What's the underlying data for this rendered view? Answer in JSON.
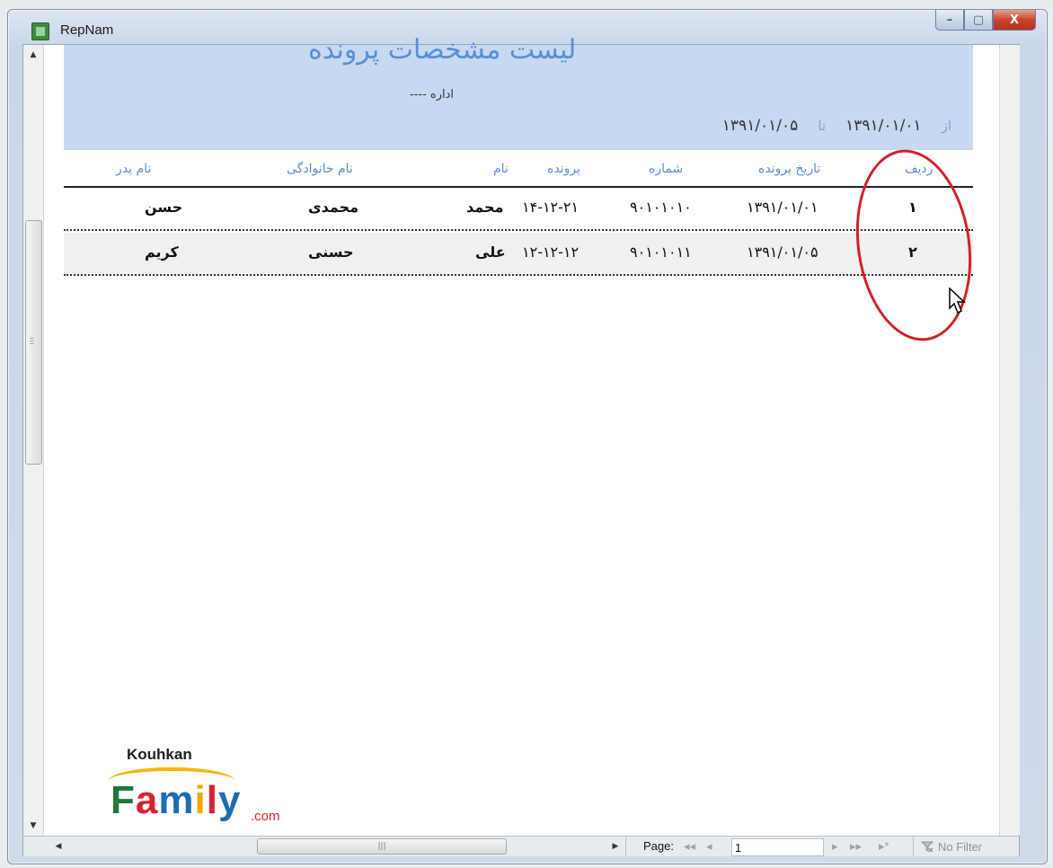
{
  "window": {
    "title": "RepNam",
    "minimize": "–",
    "maximize": "▢",
    "close": "X"
  },
  "report": {
    "title": "لیست مشخصات پرونده",
    "office": "اداره ----",
    "range_from_label": "از",
    "range_from": "۱۳۹۱/۰۱/۰۱",
    "range_to_label": "تا",
    "range_to": "۱۳۹۱/۰۱/۰۵",
    "columns": {
      "row": "ردیف",
      "date": "تاریخ پرونده",
      "number": "شماره",
      "file": "پرونده",
      "name": "نام",
      "family": "نام خانوادگی",
      "father": "نام پدر"
    },
    "rows": [
      {
        "row": "۱",
        "date": "۱۳۹۱/۰۱/۰۱",
        "number": "۹۰۱۰۱۰۱۰",
        "file": "۱۴-۱۲-۲۱",
        "name": "محمد",
        "family": "محمدی",
        "father": "حسن"
      },
      {
        "row": "۲",
        "date": "۱۳۹۱/۰۱/۰۵",
        "number": "۹۰۱۰۱۰۱۱",
        "file": "۱۲-۱۲-۱۲",
        "name": "علی",
        "family": "حسنی",
        "father": "کریم"
      }
    ]
  },
  "watermark": {
    "line1": "Kouhkan",
    "line2": "Family",
    "suffix": ".com"
  },
  "statusbar": {
    "page_label": "Page:",
    "page_value": "1",
    "nav_first": "◂◂",
    "nav_prev": "◂",
    "nav_next": "▸",
    "nav_last": "▸▸",
    "nav_new": "▸*",
    "filter_label": "No Filter"
  }
}
